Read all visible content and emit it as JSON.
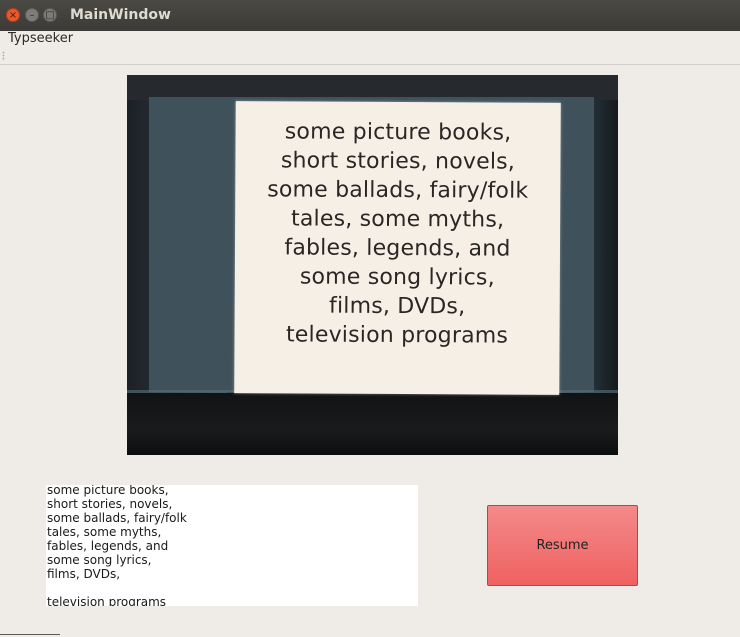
{
  "window": {
    "title": "MainWindow",
    "controls": {
      "close": "×",
      "minimize": "–",
      "maximize": "□"
    }
  },
  "menubar": {
    "items": [
      {
        "label": "Typseeker"
      }
    ]
  },
  "camera": {
    "paper_text": "some picture books,\nshort stories, novels,\nsome ballads, fairy/folk\ntales, some myths,\nfables, legends, and\nsome song lyrics,\nfilms, DVDs,\ntelevision programs"
  },
  "ocr_output": {
    "value": "some picture books,\nshort stories, novels,\nsome ballads, fairy/folk\ntales, some myths,\nfables, legends, and\nsome song lyrics,\nfilms, DVDs,\n\ntelevision programs"
  },
  "actions": {
    "resume_label": "Resume",
    "resume_color": "#f07474"
  },
  "icons": [
    "close-icon",
    "minimize-icon",
    "maximize-icon",
    "toolbar-grip-icon"
  ]
}
